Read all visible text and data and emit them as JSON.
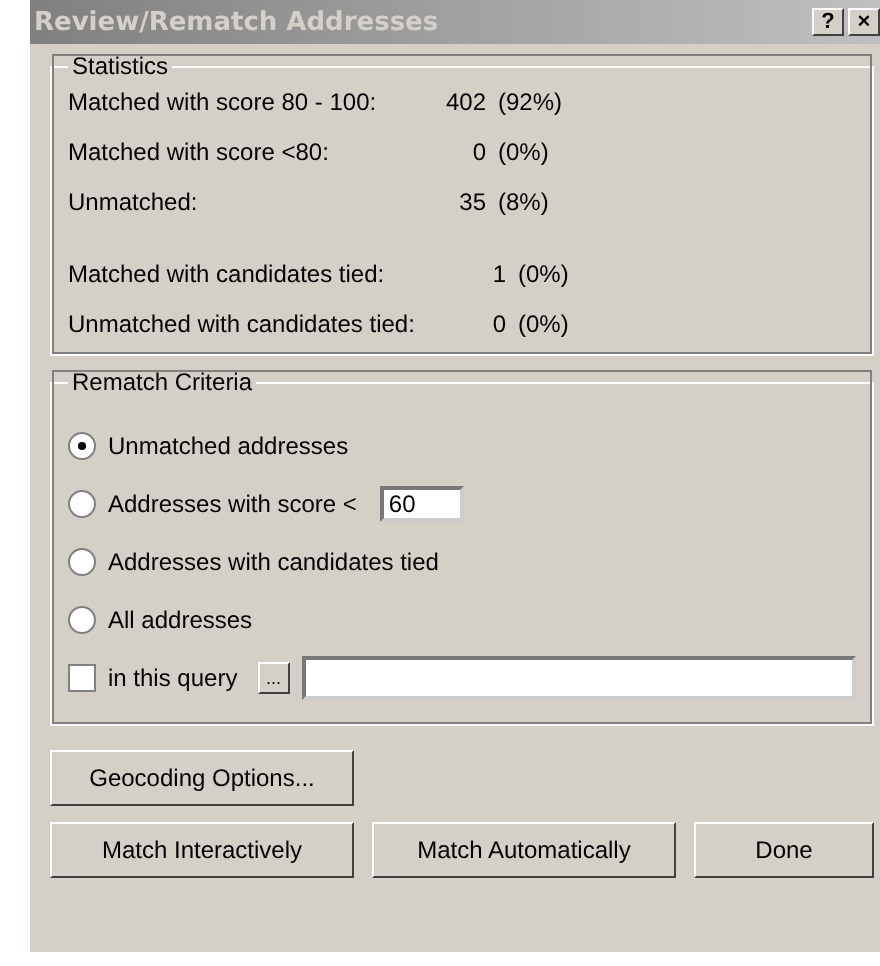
{
  "window": {
    "title": "Review/Rematch Addresses",
    "title_buttons": [
      "?",
      "×"
    ]
  },
  "statistics": {
    "title": "Statistics",
    "groups": [
      [
        {
          "label": "Matched with score 80 - 100:",
          "count": "402",
          "percent": "(92%)"
        },
        {
          "label": "Matched with score <80:",
          "count": "0",
          "percent": "(0%)"
        },
        {
          "label": "Unmatched:",
          "count": "35",
          "percent": "(8%)"
        }
      ],
      [
        {
          "label": "Matched with candidates tied:",
          "count": "1",
          "percent": "(0%)"
        },
        {
          "label": "Unmatched with candidates tied:",
          "count": "0",
          "percent": "(0%)"
        }
      ]
    ]
  },
  "rematch": {
    "title": "Rematch Criteria",
    "options": [
      {
        "label": "Unmatched addresses",
        "selected": true
      },
      {
        "label": "Addresses with score <",
        "selected": false,
        "value": "60"
      },
      {
        "label": "Addresses with candidates tied",
        "selected": false
      },
      {
        "label": "All addresses",
        "selected": false
      }
    ],
    "query": {
      "label": "in this query",
      "checked": false,
      "browse": "..."
    }
  },
  "options_button": "Geocoding Options...",
  "buttons": [
    "Match Interactively",
    "Match Automatically",
    "Done"
  ]
}
